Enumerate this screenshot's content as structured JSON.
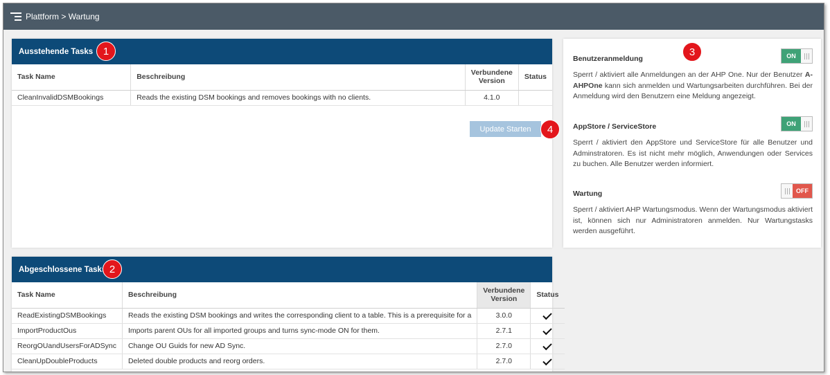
{
  "topbar": {
    "breadcrumb": "Plattform > Wartung"
  },
  "pending": {
    "title": "Ausstehende Tasks",
    "badge": "1",
    "columns": {
      "name": "Task Name",
      "desc": "Beschreibung",
      "version_line1": "Verbundene",
      "version_line2": "Version",
      "status": "Status"
    },
    "rows": [
      {
        "name": "CleanInvalidDSMBookings",
        "desc": "Reads the existing DSM bookings and removes bookings with no clients.",
        "version": "4.1.0",
        "status": ""
      }
    ],
    "update_button": "Update Starten",
    "update_badge": "4"
  },
  "completed": {
    "title": "Abgeschlossene Tasks",
    "badge": "2",
    "columns": {
      "name": "Task Name",
      "desc": "Beschreibung",
      "version_line1": "Verbundene",
      "version_line2": "Version",
      "status": "Status"
    },
    "rows": [
      {
        "name": "ReadExistingDSMBookings",
        "desc": "Reads the existing DSM bookings and writes the corresponding client to a table. This is a prerequisite for a",
        "version": "3.0.0",
        "status": "check"
      },
      {
        "name": "ImportProductOus",
        "desc": "Imports parent OUs for all imported groups and turns sync-mode ON for them.",
        "version": "2.7.1",
        "status": "check"
      },
      {
        "name": "ReorgOUandUsersForADSync",
        "desc": "Change OU Guids for new AD Sync.",
        "version": "2.7.0",
        "status": "check"
      },
      {
        "name": "CleanUpDoubleProducts",
        "desc": "Deleted double products and reorg orders.",
        "version": "2.7.0",
        "status": "check"
      }
    ]
  },
  "settings": {
    "badge": "3",
    "items": [
      {
        "title": "Benutzeranmeldung",
        "toggle": "ON",
        "desc_before": "Sperrt / aktiviert alle Anmeldungen an der AHP One. Nur der Benutzer ",
        "desc_bold": "A-AHPOne",
        "desc_after": " kann sich anmelden und Wartungsarbeiten durchführen. Bei der Anmeldung wird den Benutzern eine Meldung angezeigt."
      },
      {
        "title": "AppStore / ServiceStore",
        "toggle": "ON",
        "desc_before": "Sperrt / aktiviert den AppStore und ServiceStore für alle Benutzer und Adminstratoren. Es ist nicht mehr möglich, Anwendungen oder Services zu buchen. Alle Benutzer werden informiert.",
        "desc_bold": "",
        "desc_after": ""
      },
      {
        "title": "Wartung",
        "toggle": "OFF",
        "desc_before": "Sperrt / aktiviert AHP Wartungsmodus. Wenn der Wartungsmodus aktiviert ist, können sich nur Administratoren anmelden. Nur Wartungstasks werden ausgeführt.",
        "desc_bold": "",
        "desc_after": ""
      }
    ]
  },
  "colors": {
    "header_blue": "#0d4a78",
    "topbar": "#4b5a67",
    "badge_red": "#e3161c",
    "toggle_on": "#3fa277",
    "toggle_off": "#e1574c"
  },
  "icons": {
    "menu": "menu-icon",
    "status_done": "checkmark-icon"
  }
}
